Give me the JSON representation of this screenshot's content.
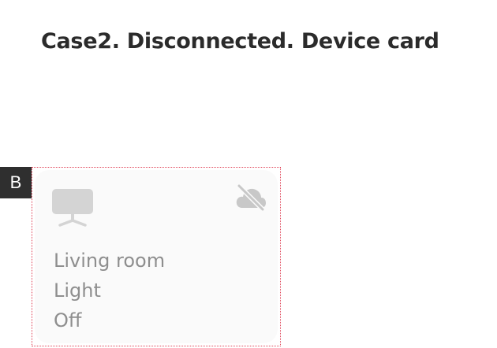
{
  "page": {
    "title": "Case2. Disconnected. Device card"
  },
  "marker": {
    "label": "B"
  },
  "device_card": {
    "room": "Living room",
    "name": "Light",
    "status": "Off",
    "device_icon": "tv-monitor-icon",
    "connection_icon": "cloud-off-icon",
    "connection_state": "disconnected",
    "colors": {
      "card_background": "#fafafa",
      "text": "#8e8e8e",
      "icon": "#c8c8c8",
      "frame": "#e0465a"
    }
  }
}
